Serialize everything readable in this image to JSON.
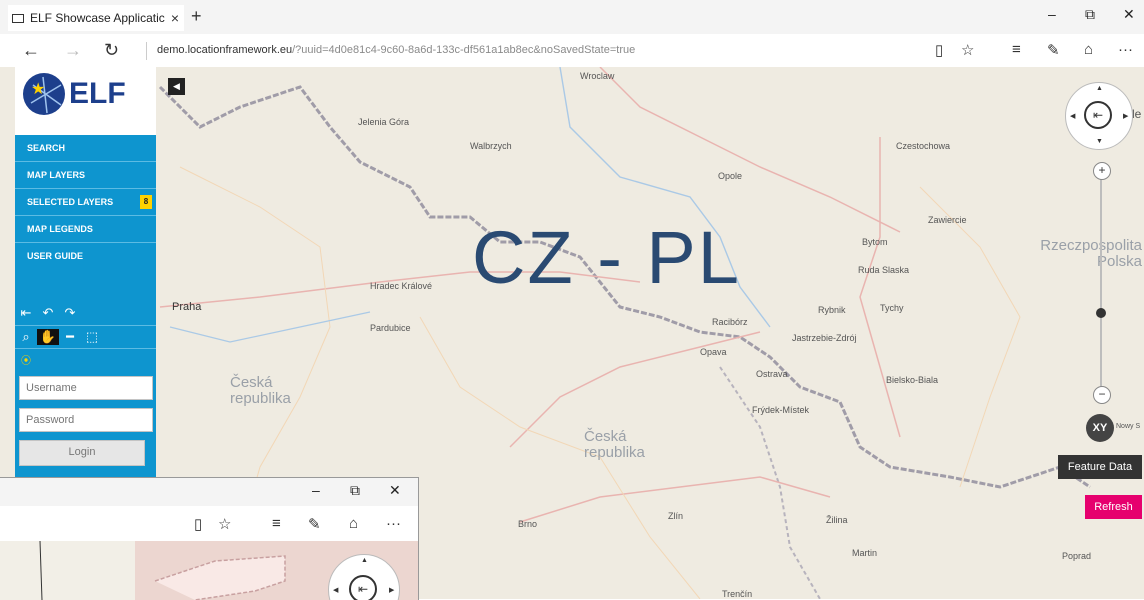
{
  "browser": {
    "tab_title": "ELF Showcase Applicatic",
    "tab_close": "×",
    "new_tab": "+",
    "url_domain": "demo.locationframework.eu",
    "url_path": "/?uuid=4d0e81c4-9c60-8a6d-133c-df561a1ab8ec&noSavedState=true",
    "minimize": "–",
    "restore": "⧉",
    "close": "✕",
    "back": "←",
    "forward": "→",
    "refresh": "↻",
    "reading_view": "▯",
    "favorite": "☆",
    "hub": "≡",
    "notes": "✎",
    "share": "⌂",
    "more": "···"
  },
  "sidebar": {
    "logo_text": "ELF",
    "menu": [
      {
        "label": "SEARCH"
      },
      {
        "label": "MAP LAYERS"
      },
      {
        "label": "SELECTED LAYERS",
        "badge": "8"
      },
      {
        "label": "MAP LEGENDS"
      },
      {
        "label": "USER GUIDE"
      }
    ],
    "username_placeholder": "Username",
    "password_placeholder": "Password",
    "login_label": "Login"
  },
  "overlay_title": "CZ - PL",
  "map_labels": [
    "Wroclaw",
    "Jelenia Góra",
    "Walbrzych",
    "Czestochowa",
    "Opole",
    "Zawiercie",
    "Bytom",
    "Ruda Slaska",
    "Hradec Králové",
    "Praha",
    "Pardubice",
    "Racibórz",
    "Rybnik",
    "Tychy",
    "Jastrzebie-Zdrój",
    "Opava",
    "Ostrava",
    "Bielsko-Biala",
    "Frýdek-Místek",
    "Brno",
    "Zlín",
    "Žilina",
    "Martin",
    "Poprad",
    "Nowy S",
    "Trenčín",
    "le"
  ],
  "map_big_labels": [
    "Česká republika",
    "Česká republika",
    "Rzeczpospolita Polska"
  ],
  "controls": {
    "zoom_in": "+",
    "zoom_out": "−",
    "xy_label": "XY",
    "feature_data_label": "Feature Data",
    "refresh_label": "Refresh"
  },
  "colors": {
    "sidebar_blue": "#0e95cf",
    "refresh_pink": "#e6006e",
    "title_blue": "#2a4a72",
    "border_red": "#c8a0a0"
  }
}
